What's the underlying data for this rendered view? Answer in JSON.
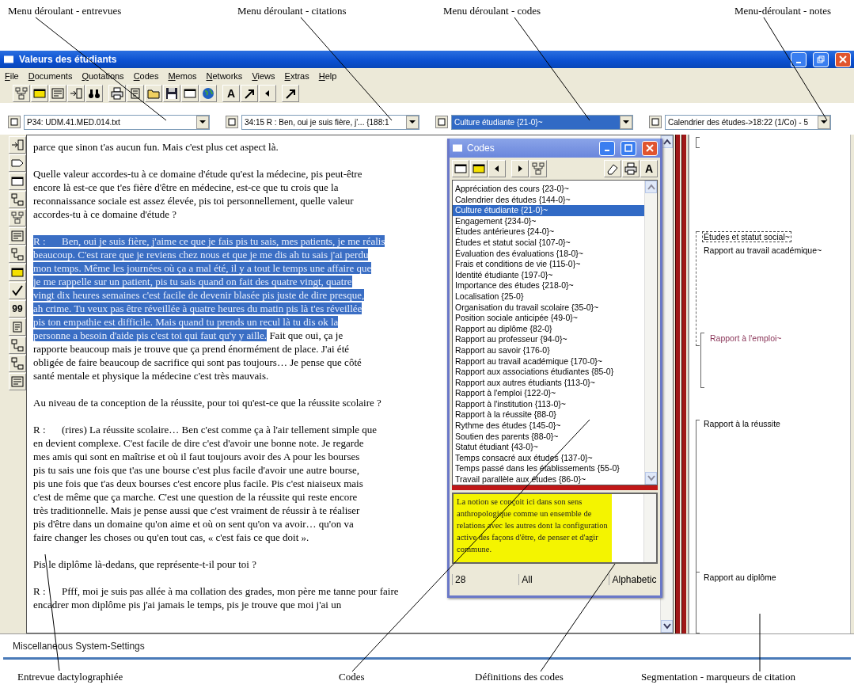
{
  "annotations_top": [
    {
      "label": "Menu déroulant - entrevues"
    },
    {
      "label": "Menu déroulant - citations"
    },
    {
      "label": "Menu déroulant - codes"
    },
    {
      "label": "Menu-déroulant - notes"
    }
  ],
  "window": {
    "title": "Valeurs des étudiants"
  },
  "menu": [
    "File",
    "Documents",
    "Quotations",
    "Codes",
    "Memos",
    "Networks",
    "Views",
    "Extras",
    "Help"
  ],
  "toolbar": {
    "font_label": "A"
  },
  "dropdowns": [
    {
      "value": "P34: UDM.41.MED.014.txt",
      "highlighted": false
    },
    {
      "value": "34:15 R : Ben, oui je suis fière, j'... {188:1",
      "highlighted": false
    },
    {
      "value": "Culture étudiante {21-0}~",
      "highlighted": true
    },
    {
      "value": "Calendrier des études->18:22 (1/Co) - 5",
      "highlighted": false
    }
  ],
  "side_toolbar": {
    "count_label": "99"
  },
  "document": {
    "paragraphs": [
      {
        "lines": [
          {
            "text": "parce que sinon t'as aucun fun. Mais c'est plus cet aspect là.",
            "selected": false
          }
        ]
      },
      {
        "lines": [
          {
            "text": "Quelle valeur accordes-tu à ce domaine d'étude qu'est la médecine, pis peut-être",
            "selected": false
          },
          {
            "text": "encore là est-ce que t'es fière d'être en médecine, est-ce que tu crois que la",
            "selected": false
          },
          {
            "text": "reconnaissance sociale est assez élevée, pis toi personnellement, quelle valeur",
            "selected": false
          },
          {
            "text": "accordes-tu à ce domaine d'étude ?",
            "selected": false
          }
        ]
      },
      {
        "speaker": "R :",
        "lines": [
          {
            "text": "Ben, oui je suis fière, j'aime ce que je fais pis tu sais, mes patients, je me réalis",
            "selected": true
          },
          {
            "text": "beaucoup. C'est rare que je reviens chez nous et que je me dis ah tu sais j'ai perdu",
            "selected": true
          },
          {
            "text": "mon temps. Même les journées où ça a mal été, il y a tout le temps une affaire que",
            "selected": true
          },
          {
            "text": "je me rappelle sur un patient, pis tu sais quand on fait des quatre vingt, quatre",
            "selected": true
          },
          {
            "text": "vingt dix heures semaines c'est facile de devenir blasée pis juste de dire presque,",
            "selected": true
          },
          {
            "text": "ah crime. Tu veux pas être réveillée à quatre heures du matin pis là t'es réveillée",
            "selected": true
          },
          {
            "text": "pis ton empathie est difficile. Mais quand tu prends un recul là tu dis ok la",
            "selected": true
          },
          {
            "text": "personne a besoin d'aide pis c'est toi qui faut qu'y y aille.",
            "selected": true,
            "after": " Fait que oui, ça je"
          },
          {
            "text": "rapporte beaucoup mais je trouve que ça prend énormément de place. J'ai été",
            "selected": false
          },
          {
            "text": "obligée de faire beaucoup de sacrifice qui sont pas toujours… Je pense que côté",
            "selected": false
          },
          {
            "text": "santé mentale et physique la médecine c'est très mauvais.",
            "selected": false
          }
        ]
      },
      {
        "lines": [
          {
            "text": "Au niveau de ta conception de la réussite, pour toi qu'est-ce que la réussite scolaire ?",
            "selected": false
          }
        ]
      },
      {
        "speaker": "R :",
        "lines": [
          {
            "text": "(rires) La réussite scolaire… Ben c'est comme ça à l'air tellement simple que",
            "selected": false
          },
          {
            "text": "en devient complexe. C'est facile de dire c'est d'avoir une bonne note. Je regarde",
            "selected": false
          },
          {
            "text": "mes amis qui sont en maîtrise et où il faut toujours avoir des A pour les bourses",
            "selected": false
          },
          {
            "text": "pis tu sais une fois que t'as une bourse c'est plus facile d'avoir une autre bourse,",
            "selected": false
          },
          {
            "text": "pis une fois que t'as deux bourses c'est encore plus facile. Pis c'est niaiseux mais",
            "selected": false
          },
          {
            "text": "c'est de même que ça marche. C'est une question de la réussite qui reste encore",
            "selected": false
          },
          {
            "text": "très traditionnelle. Mais je pense aussi que c'est vraiment de réussir à te réaliser",
            "selected": false
          },
          {
            "text": "pis d'être dans un domaine qu'on aime et où on sent qu'on va avoir… qu'on va",
            "selected": false
          },
          {
            "text": "faire changer les choses ou qu'en tout cas, « c'est fais ce que doit ».",
            "selected": false
          }
        ]
      },
      {
        "lines": [
          {
            "text": "Pis le diplôme là-dedans, que représente-t-il pour toi ?",
            "selected": false
          }
        ]
      },
      {
        "speaker": "R :",
        "lines": [
          {
            "text": "Pfff, moi je suis pas allée à ma collation des grades, mon père me tanne pour faire",
            "selected": false
          },
          {
            "text": "encadrer mon diplôme pis j'ai jamais le temps, pis je trouve que moi j'ai un",
            "selected": false
          }
        ]
      }
    ]
  },
  "codes_window": {
    "title": "Codes",
    "font_label": "A",
    "items": [
      {
        "label": "Appréciation des cours {23-0}~",
        "selected": false
      },
      {
        "label": "Calendrier des études {144-0}~",
        "selected": false
      },
      {
        "label": "Culture étudiante {21-0}~",
        "selected": true
      },
      {
        "label": "Engagement {234-0}~",
        "selected": false
      },
      {
        "label": "Études antérieures {24-0}~",
        "selected": false
      },
      {
        "label": "Études et statut social {107-0}~",
        "selected": false
      },
      {
        "label": "Évaluation des évaluations {18-0}~",
        "selected": false
      },
      {
        "label": "Frais et conditions de vie {115-0}~",
        "selected": false
      },
      {
        "label": "Identité étudiante {197-0}~",
        "selected": false
      },
      {
        "label": "Importance des études {218-0}~",
        "selected": false
      },
      {
        "label": "Localisation {25-0}",
        "selected": false
      },
      {
        "label": "Organisation du travail scolaire {35-0}~",
        "selected": false
      },
      {
        "label": "Position sociale anticipée {49-0}~",
        "selected": false
      },
      {
        "label": "Rapport au diplôme {82-0}",
        "selected": false
      },
      {
        "label": "Rapport au professeur {94-0}~",
        "selected": false
      },
      {
        "label": "Rapport au savoir {176-0}",
        "selected": false
      },
      {
        "label": "Rapport au travail académique {170-0}~",
        "selected": false
      },
      {
        "label": "Rapport aux associations étudiantes {85-0}",
        "selected": false
      },
      {
        "label": "Rapport aux autres étudiants {113-0}~",
        "selected": false
      },
      {
        "label": "Rapport à l'emploi {122-0}~",
        "selected": false
      },
      {
        "label": "Rapport à l'institution {113-0}~",
        "selected": false
      },
      {
        "label": "Rapport à la réussite {88-0}",
        "selected": false
      },
      {
        "label": "Rythme des études {145-0}~",
        "selected": false
      },
      {
        "label": "Soutien des parents {88-0}~",
        "selected": false
      },
      {
        "label": "Statut étudiant {43-0}~",
        "selected": false
      },
      {
        "label": "Temps consacré aux études {137-0}~",
        "selected": false
      },
      {
        "label": "Temps passé dans les établissements {55-0}",
        "selected": false
      },
      {
        "label": "Travail parallèle aux études {86-0}~",
        "selected": false
      }
    ],
    "definition": "La notion se conçoit ici dans son sens anthropologique comme un ensemble de relations avec les autres dont la configuration active des façons d'être, de penser et d'agir commune.",
    "status": {
      "count": "28",
      "filter": "All",
      "sort": "Alphabetic"
    }
  },
  "margin": {
    "codes": [
      {
        "label": "Études et statut social~",
        "color": "#000000",
        "focused": true
      },
      {
        "label": "Rapport au travail académique~",
        "color": "#000000",
        "focused": false
      },
      {
        "label": "Rapport à l'emploi~",
        "color": "#8a3558",
        "focused": false
      },
      {
        "label": "Rapport à la réussite",
        "color": "#000000",
        "focused": false
      },
      {
        "label": "Rapport au diplôme",
        "color": "#000000",
        "focused": false
      }
    ]
  },
  "status_bar": "Miscellaneous System-Settings",
  "annotations_bottom": [
    {
      "label": "Entrevue dactylographiée"
    },
    {
      "label": "Codes"
    },
    {
      "label": "Définitions des codes"
    },
    {
      "label": "Segmentation - marqueurs de citation"
    }
  ]
}
